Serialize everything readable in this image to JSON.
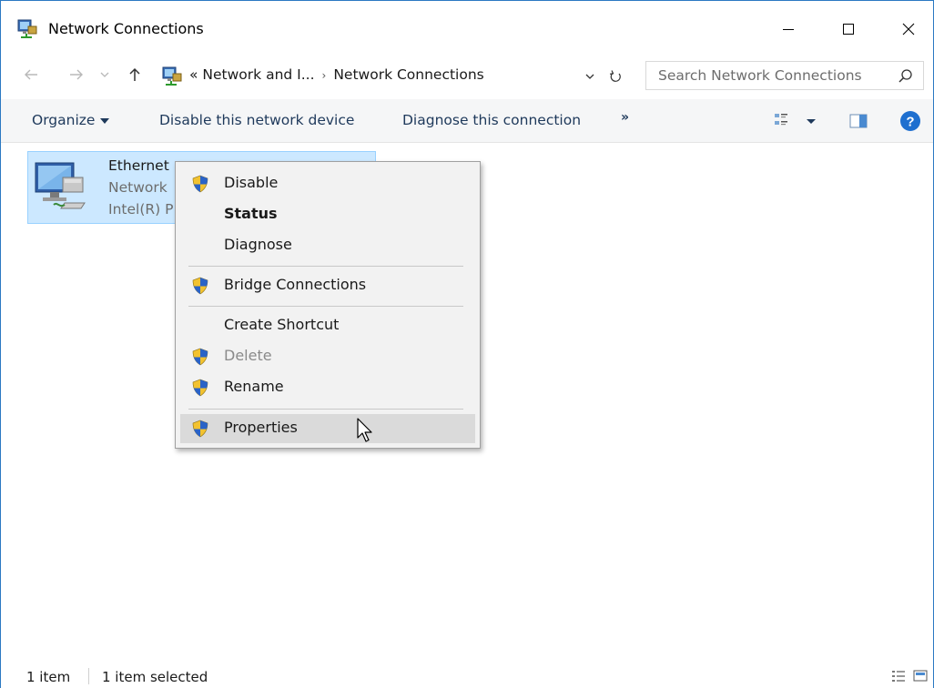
{
  "window": {
    "title": "Network Connections",
    "accent_color": "#2b79c2"
  },
  "titlebar_buttons": {
    "minimize": "minimize-icon",
    "maximize": "maximize-icon",
    "close": "close-icon"
  },
  "address": {
    "prefix": "«",
    "crumb1": "Network and I...",
    "separator": "›",
    "crumb2": "Network Connections"
  },
  "search": {
    "placeholder": "Search Network Connections"
  },
  "commandbar": {
    "organize": "Organize",
    "disable": "Disable this network device",
    "diagnose": "Diagnose this connection",
    "more": "»"
  },
  "item": {
    "name": "Ethernet",
    "status": "Network",
    "device": "Intel(R) P",
    "selection_color": "#cce8ff"
  },
  "context_menu": {
    "items": [
      {
        "label": "Disable",
        "shield": true
      },
      {
        "label": "Status",
        "shield": false,
        "bold": true
      },
      {
        "label": "Diagnose",
        "shield": false
      },
      {
        "label": "Bridge Connections",
        "shield": true
      },
      {
        "label": "Create Shortcut",
        "shield": false
      },
      {
        "label": "Delete",
        "shield": true,
        "disabled": true
      },
      {
        "label": "Rename",
        "shield": true
      },
      {
        "label": "Properties",
        "shield": true,
        "hovered": true
      }
    ]
  },
  "statusbar": {
    "count": "1 item",
    "selected": "1 item selected"
  }
}
